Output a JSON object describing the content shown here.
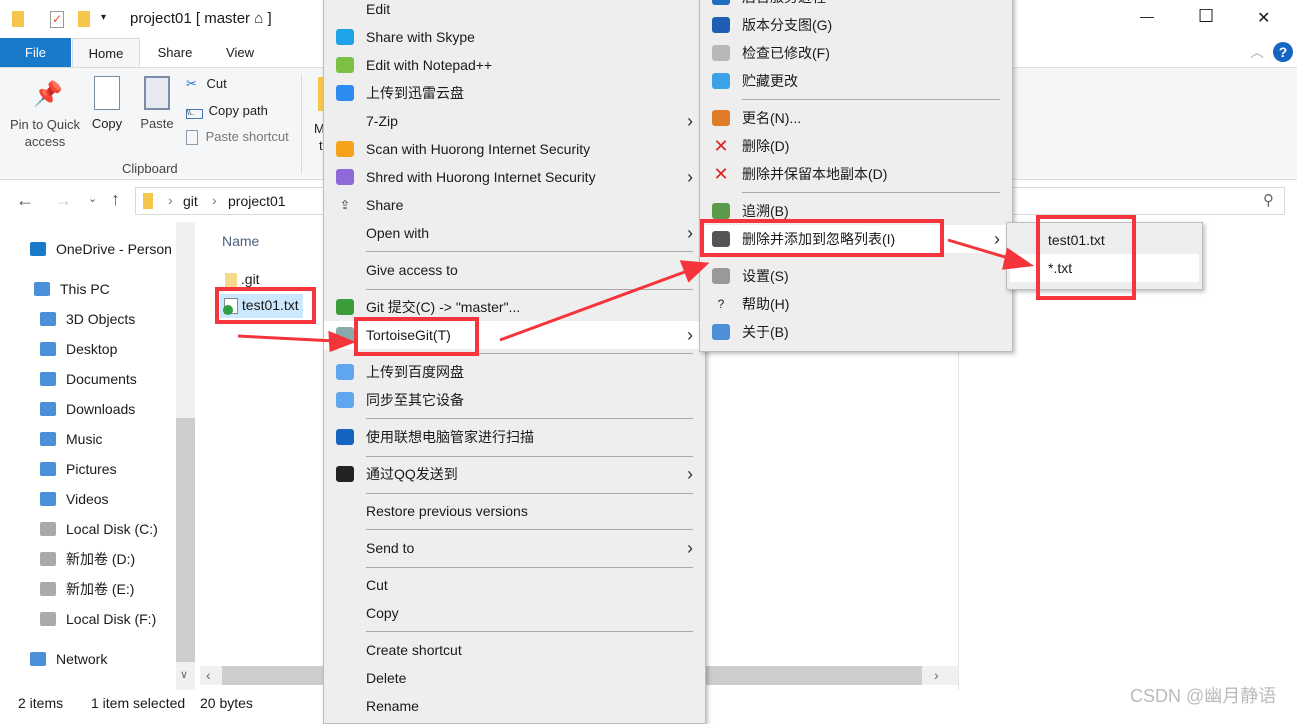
{
  "window": {
    "title": "project01 [ master ⌂ ]",
    "minimize": "—",
    "maximize": "☐",
    "close": "✕"
  },
  "ribbon_tabs": [
    "File",
    "Home",
    "Share",
    "View"
  ],
  "clipboard": {
    "pin": "Pin to Quick access",
    "copy": "Copy",
    "paste": "Paste",
    "cut": "Cut",
    "copy_path": "Copy path",
    "paste_shortcut": "Paste shortcut",
    "group": "Clipboard",
    "partial1": "M",
    "partial2": "t"
  },
  "address": {
    "crumbs": [
      "git",
      "project01"
    ]
  },
  "nav": [
    {
      "label": "OneDrive - Person",
      "icon": "onedrive-icon"
    },
    {
      "label": "This PC",
      "icon": "pc-icon"
    },
    {
      "label": "3D Objects",
      "icon": "3d-objects-icon"
    },
    {
      "label": "Desktop",
      "icon": "desktop-icon"
    },
    {
      "label": "Documents",
      "icon": "documents-icon"
    },
    {
      "label": "Downloads",
      "icon": "downloads-icon"
    },
    {
      "label": "Music",
      "icon": "music-icon"
    },
    {
      "label": "Pictures",
      "icon": "pictures-icon"
    },
    {
      "label": "Videos",
      "icon": "videos-icon"
    },
    {
      "label": "Local Disk (C:)",
      "icon": "disk-icon"
    },
    {
      "label": "新加卷 (D:)",
      "icon": "disk-icon"
    },
    {
      "label": "新加卷 (E:)",
      "icon": "disk-icon"
    },
    {
      "label": "Local Disk (F:)",
      "icon": "disk-icon"
    },
    {
      "label": "Network",
      "icon": "network-icon"
    }
  ],
  "files": {
    "header": "Name",
    "items": [
      ".git",
      "test01.txt"
    ]
  },
  "status": {
    "count": "2 items",
    "selected": "1 item selected",
    "size": "20 bytes"
  },
  "context_menu": [
    {
      "label": "Edit"
    },
    {
      "label": "Share with Skype",
      "icon": "skype-icon"
    },
    {
      "label": "Edit with Notepad++",
      "icon": "notepadpp-icon"
    },
    {
      "label": "上传到迅雷云盘",
      "icon": "xunlei-icon"
    },
    {
      "label": "7-Zip",
      "sub": true
    },
    {
      "label": "Scan with Huorong Internet Security",
      "icon": "huorong-shield-icon"
    },
    {
      "label": "Shred with Huorong Internet Security",
      "icon": "shredder-icon",
      "sub": true
    },
    {
      "label": "Share",
      "icon": "share-icon"
    },
    {
      "label": "Open with",
      "sub": true
    },
    {
      "label": "Give access to",
      "sub": true
    },
    {
      "label": "Git 提交(C) -> \"master\"...",
      "icon": "git-commit-icon"
    },
    {
      "label": "TortoiseGit(T)",
      "icon": "tortoisegit-icon",
      "sub": true
    },
    {
      "label": "上传到百度网盘",
      "icon": "baidu-icon"
    },
    {
      "label": "同步至其它设备",
      "icon": "baidu-sync-icon"
    },
    {
      "label": "使用联想电脑管家进行扫描",
      "icon": "lenovo-icon"
    },
    {
      "label": "通过QQ发送到",
      "icon": "qq-icon",
      "sub": true
    },
    {
      "label": "Restore previous versions"
    },
    {
      "label": "Send to",
      "sub": true
    },
    {
      "label": "Cut"
    },
    {
      "label": "Copy"
    },
    {
      "label": "Create shortcut"
    },
    {
      "label": "Delete"
    },
    {
      "label": "Rename"
    }
  ],
  "tortoise_menu": [
    {
      "label": "后台服务进程",
      "icon": "daemon-icon"
    },
    {
      "label": "版本分支图(G)",
      "icon": "revision-graph-icon"
    },
    {
      "label": "检查已修改(F)",
      "icon": "check-modifications-icon"
    },
    {
      "label": "贮藏更改",
      "icon": "stash-icon"
    },
    {
      "label": "更名(N)...",
      "icon": "rename-pencil-icon"
    },
    {
      "label": "删除(D)",
      "icon": "delete-x-icon"
    },
    {
      "label": "删除并保留本地副本(D)",
      "icon": "delete-x-icon"
    },
    {
      "label": "追溯(B)",
      "icon": "blame-icon"
    },
    {
      "label": "删除并添加到忽略列表(I)",
      "icon": "ignore-icon",
      "sub": true
    },
    {
      "label": "设置(S)",
      "icon": "settings-wrench-icon"
    },
    {
      "label": "帮助(H)",
      "icon": "help-icon"
    },
    {
      "label": "关于(B)",
      "icon": "about-icon"
    }
  ],
  "ignore_menu": [
    "test01.txt",
    "*.txt"
  ],
  "watermark": "CSDN @幽月静语",
  "colors": {
    "accent": "#1979ca",
    "annotation": "#f5353b",
    "menu_bg": "#eeeeee"
  }
}
